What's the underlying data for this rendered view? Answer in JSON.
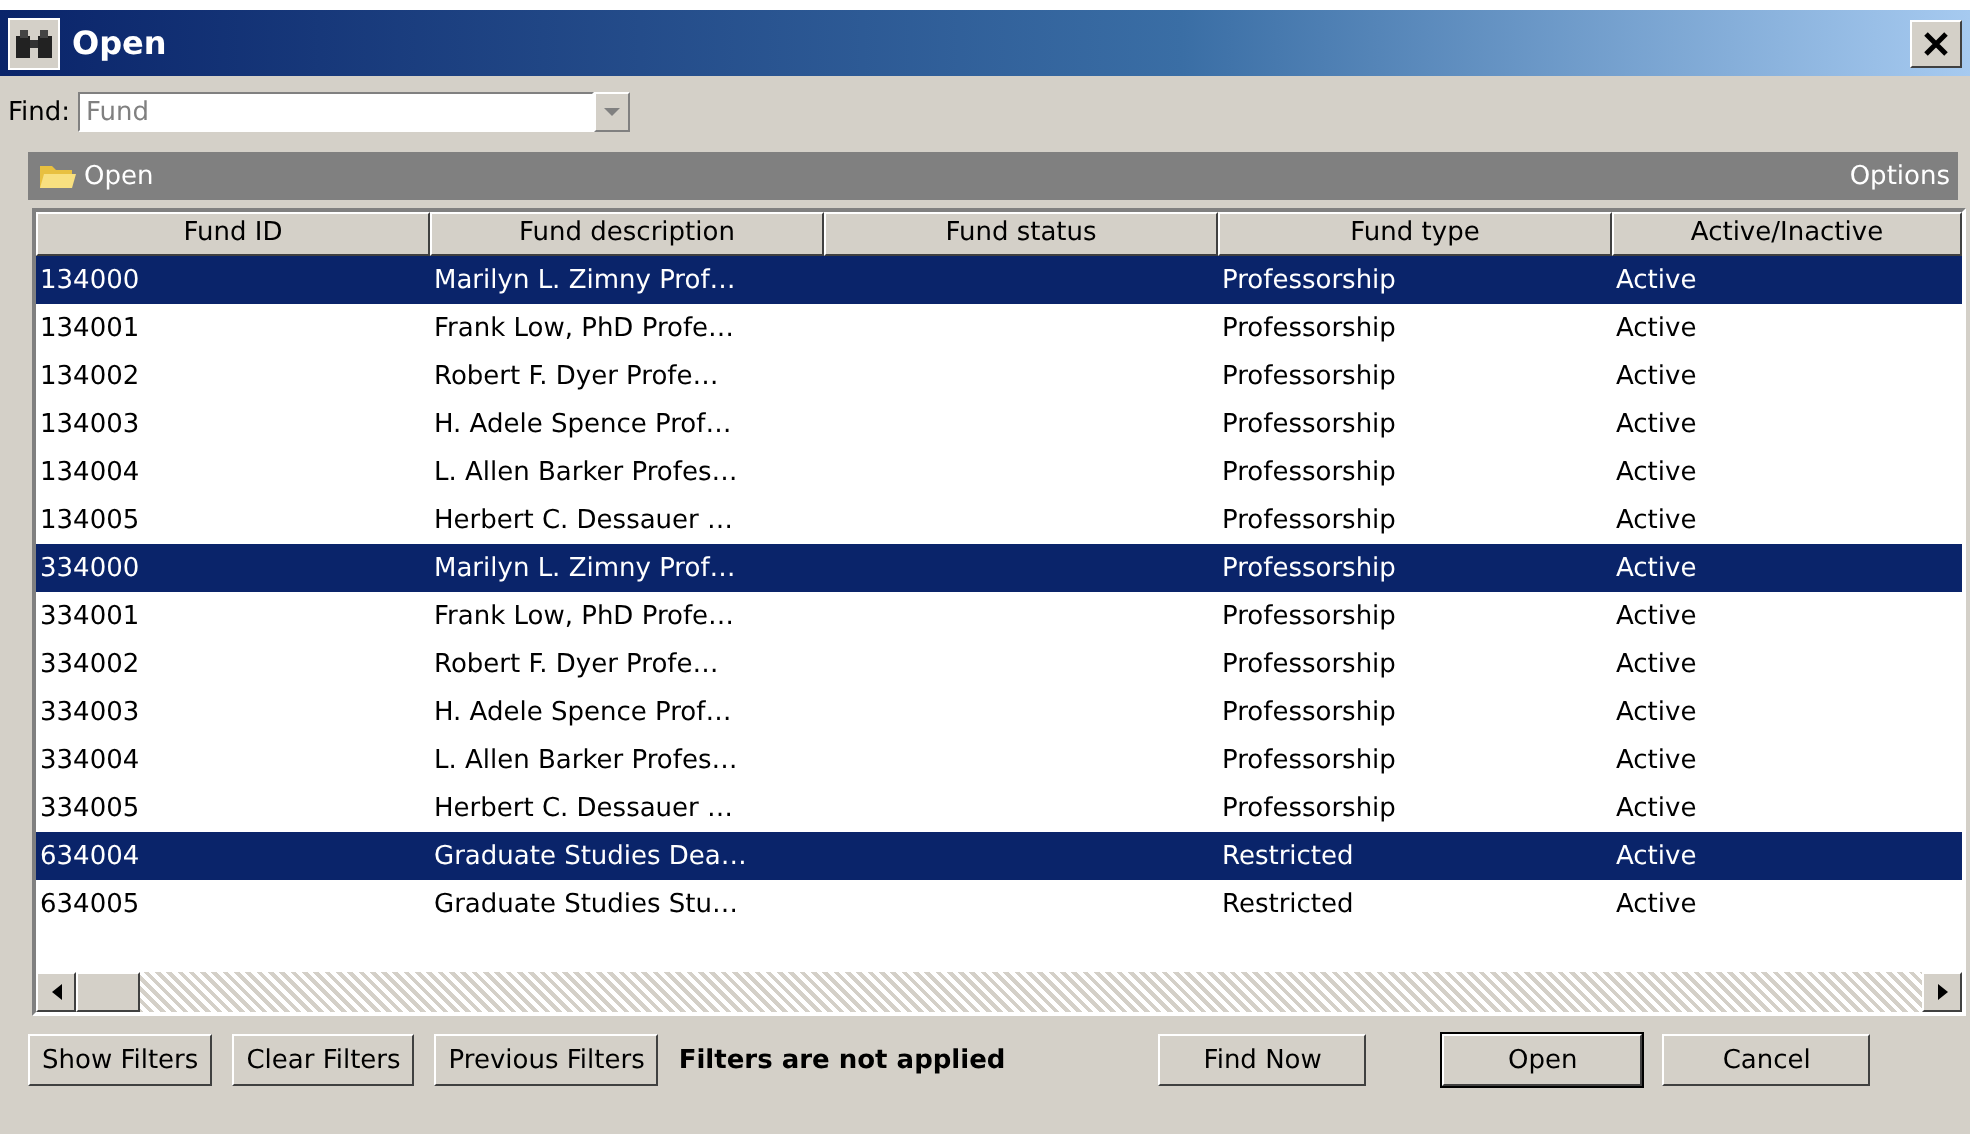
{
  "window": {
    "title": "Open"
  },
  "find": {
    "label": "Find:",
    "value": "Fund"
  },
  "toolbar": {
    "open": "Open",
    "options": "Options"
  },
  "table": {
    "columns": [
      "Fund ID",
      "Fund description",
      "Fund status",
      "Fund type",
      "Active/Inactive"
    ],
    "rows": [
      {
        "selected": true,
        "cells": [
          "134000",
          "Marilyn L. Zimny Prof…",
          "",
          "Professorship",
          "Active"
        ]
      },
      {
        "selected": false,
        "cells": [
          "134001",
          "Frank Low, PhD Profe…",
          "",
          "Professorship",
          "Active"
        ]
      },
      {
        "selected": false,
        "cells": [
          "134002",
          "Robert F. Dyer Profe…",
          "",
          "Professorship",
          "Active"
        ]
      },
      {
        "selected": false,
        "cells": [
          "134003",
          "H. Adele Spence Prof…",
          "",
          "Professorship",
          "Active"
        ]
      },
      {
        "selected": false,
        "cells": [
          "134004",
          "L. Allen Barker Profes…",
          "",
          "Professorship",
          "Active"
        ]
      },
      {
        "selected": false,
        "cells": [
          "134005",
          "Herbert C. Dessauer …",
          "",
          "Professorship",
          "Active"
        ]
      },
      {
        "selected": true,
        "cells": [
          "334000",
          "Marilyn L. Zimny Prof…",
          "",
          "Professorship",
          "Active"
        ]
      },
      {
        "selected": false,
        "cells": [
          "334001",
          "Frank Low, PhD Profe…",
          "",
          "Professorship",
          "Active"
        ]
      },
      {
        "selected": false,
        "cells": [
          "334002",
          "Robert F. Dyer Profe…",
          "",
          "Professorship",
          "Active"
        ]
      },
      {
        "selected": false,
        "cells": [
          "334003",
          "H. Adele Spence Prof…",
          "",
          "Professorship",
          "Active"
        ]
      },
      {
        "selected": false,
        "cells": [
          "334004",
          "L. Allen Barker Profes…",
          "",
          "Professorship",
          "Active"
        ]
      },
      {
        "selected": false,
        "cells": [
          "334005",
          "Herbert C. Dessauer …",
          "",
          "Professorship",
          "Active"
        ]
      },
      {
        "selected": true,
        "cells": [
          "634004",
          "Graduate Studies Dea…",
          "",
          "Restricted",
          "Active"
        ]
      },
      {
        "selected": false,
        "cells": [
          "634005",
          "Graduate Studies Stu…",
          "",
          "Restricted",
          "Active"
        ]
      }
    ]
  },
  "footer": {
    "left_buttons": [
      "Show Filters",
      "Clear Filters",
      "Previous Filters"
    ],
    "status": "Filters are not applied",
    "find_now": "Find Now",
    "open": "Open",
    "cancel": "Cancel"
  }
}
